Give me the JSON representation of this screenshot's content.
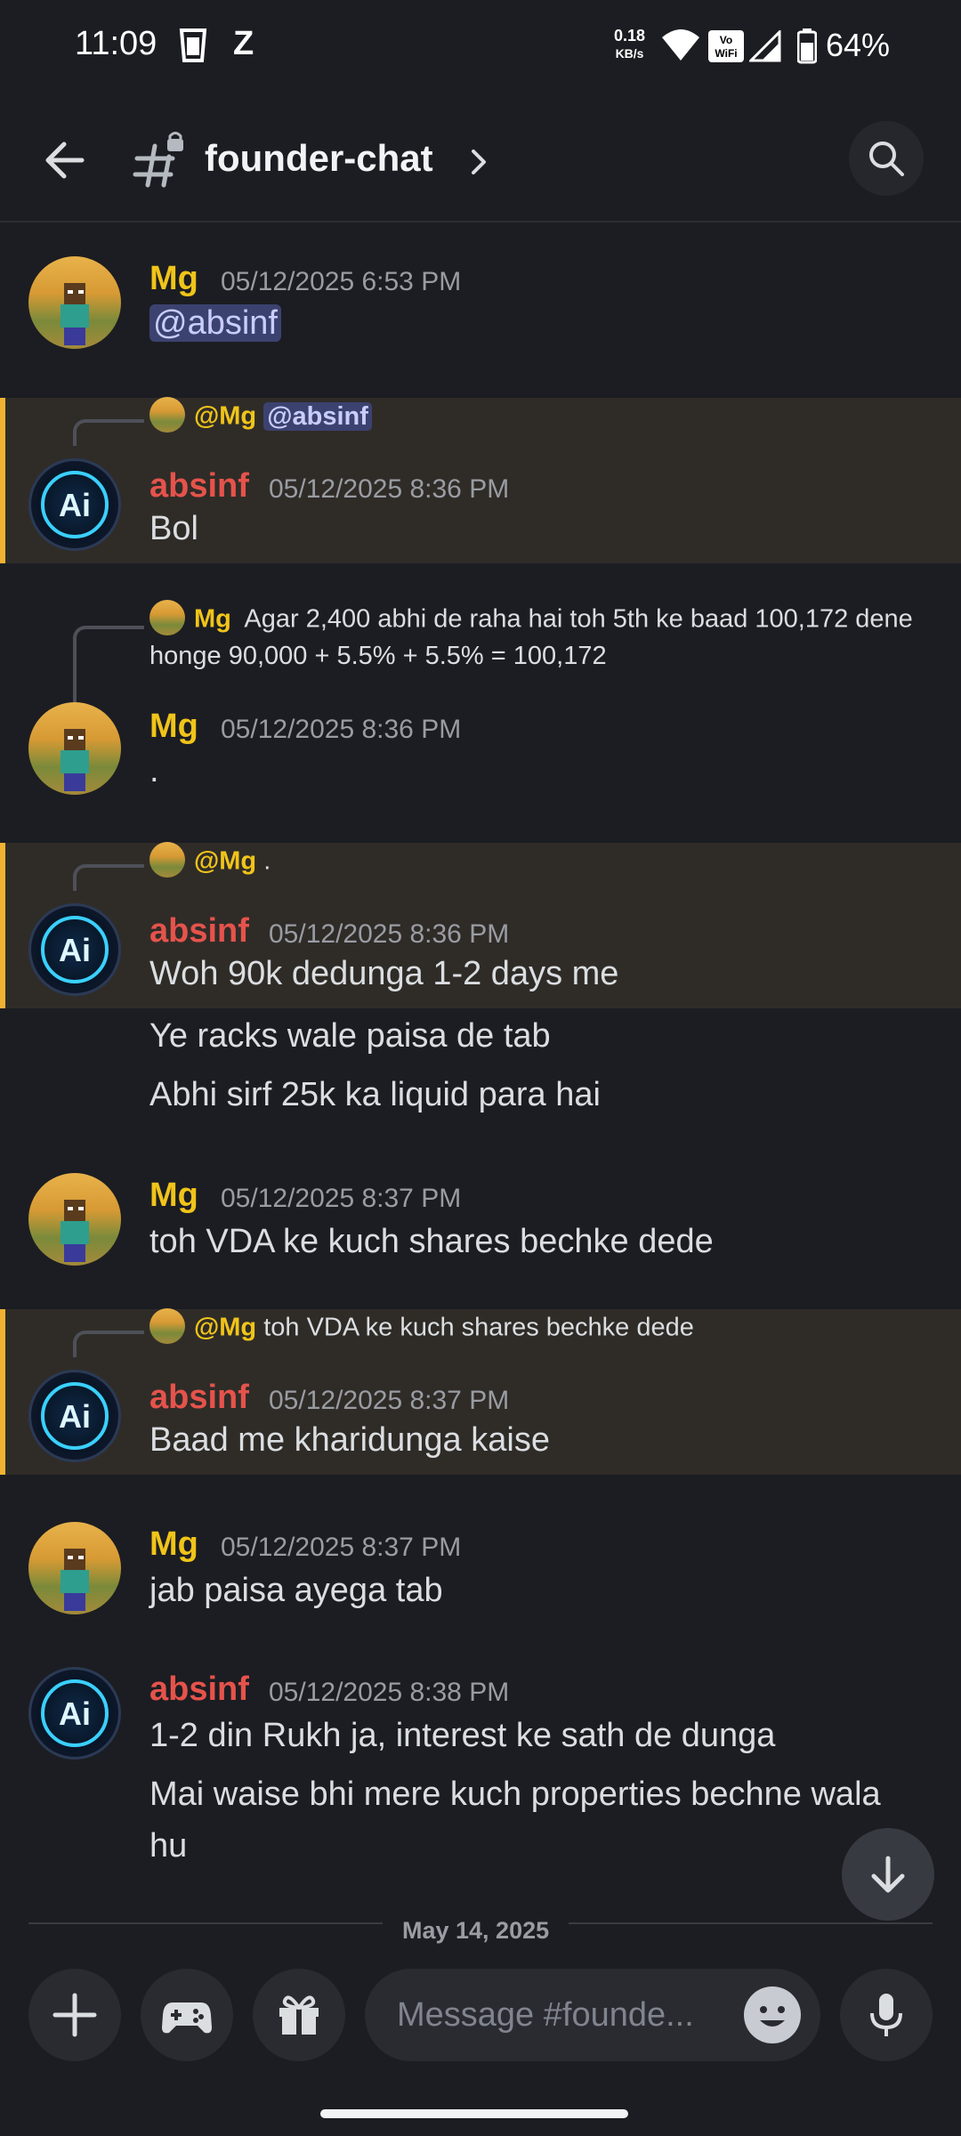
{
  "status_bar": {
    "time": "11:09",
    "carrier_glyph": "Z",
    "net_speed_value": "0.18",
    "net_speed_unit": "KB/s",
    "vowifi": "Vo WiFi",
    "battery": "64%"
  },
  "header": {
    "channel_name": "founder-chat"
  },
  "messages": [
    {
      "author": "Mg",
      "timestamp": "05/12/2025 6:53 PM",
      "lines": [
        "@absinf"
      ]
    },
    {
      "author": "absinf",
      "timestamp": "05/12/2025 8:36 PM",
      "reply_to_author": "@Mg",
      "reply_text": "@absinf",
      "lines": [
        "Bol"
      ]
    },
    {
      "author": "Mg",
      "timestamp": "05/12/2025 8:36 PM",
      "reply_to_author": "Mg",
      "reply_text_line1": "Agar 2,400 abhi de raha hai toh 5th ke baad 100,172 dene",
      "reply_text_line2": "honge  90,000 + 5.5% + 5.5% = 100,172",
      "lines": [
        "."
      ]
    },
    {
      "author": "absinf",
      "timestamp": "05/12/2025 8:36 PM",
      "reply_to_author": "@Mg",
      "reply_text": ".",
      "lines": [
        "Woh 90k dedunga 1-2 days me",
        "Ye racks wale paisa de tab",
        "Abhi sirf 25k ka liquid para hai"
      ]
    },
    {
      "author": "Mg",
      "timestamp": "05/12/2025 8:37 PM",
      "lines": [
        "toh VDA ke kuch shares bechke dede"
      ]
    },
    {
      "author": "absinf",
      "timestamp": "05/12/2025 8:37 PM",
      "reply_to_author": "@Mg",
      "reply_text": "toh VDA ke kuch shares bechke dede",
      "lines": [
        "Baad me kharidunga kaise"
      ]
    },
    {
      "author": "Mg",
      "timestamp": "05/12/2025 8:37 PM",
      "lines": [
        "jab paisa ayega tab"
      ]
    },
    {
      "author": "absinf",
      "timestamp": "05/12/2025 8:38 PM",
      "lines": [
        "1-2 din Rukh ja, interest ke sath de dunga",
        "Mai waise bhi mere kuch properties bechne wala",
        "hu"
      ]
    }
  ],
  "date_divider": "May 14, 2025",
  "composer": {
    "placeholder": "Message #founde..."
  },
  "colors": {
    "mg_name": "#f0c419",
    "absinf_name": "#e5534b",
    "highlight_bar": "#f0b232",
    "background": "#1c1d22"
  }
}
